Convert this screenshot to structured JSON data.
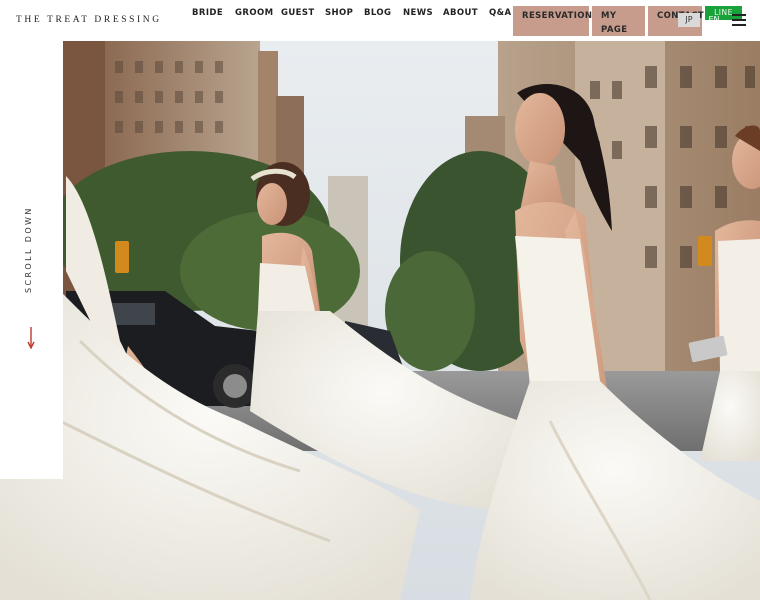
{
  "header": {
    "logo": "THE TREAT DRESSING",
    "nav": [
      "BRIDE",
      "GROOM",
      "GUEST",
      "SHOP",
      "BLOG",
      "NEWS",
      "ABOUT",
      "Q&A"
    ],
    "reservation_label": "RESERVATION",
    "mypage_line1": "MY",
    "mypage_line2": "PAGE",
    "contact_label": "CONTACT",
    "lang_jp": "JP",
    "lang_en": "EN",
    "line_label": "LINE"
  },
  "hero": {
    "scroll_label": "SCROLL DOWN"
  },
  "colors": {
    "accent": "#c79c8d",
    "line_green": "#1aa23a",
    "arrow": "#c0392b"
  },
  "icons": [
    "menu-icon",
    "arrow-down-icon"
  ]
}
